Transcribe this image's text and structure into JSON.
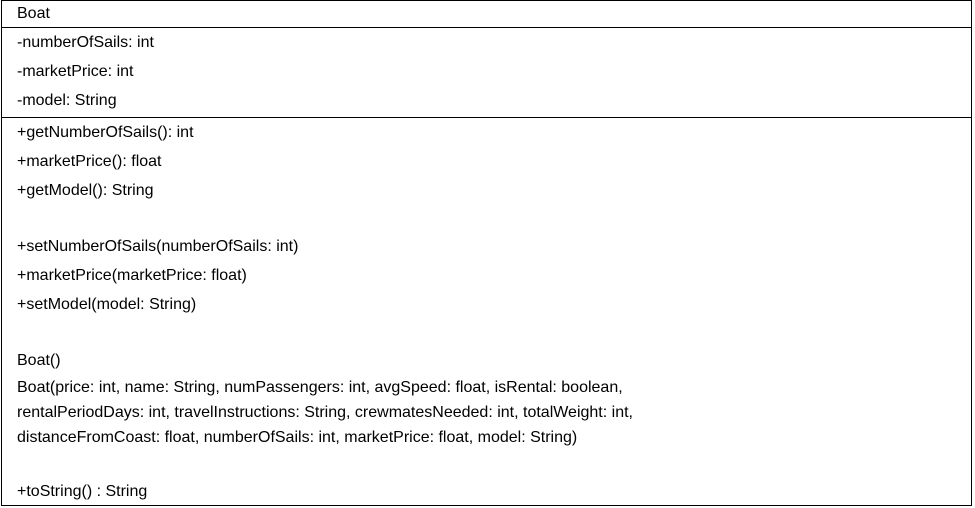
{
  "class_name": "Boat",
  "attributes": [
    "-numberOfSails: int",
    "-marketPrice: int",
    "-model: String"
  ],
  "operations": {
    "getters": [
      "+getNumberOfSails(): int",
      "+marketPrice(): float",
      "+getModel(): String"
    ],
    "setters": [
      "+setNumberOfSails(numberOfSails: int)",
      "+marketPrice(marketPrice: float)",
      "+setModel(model: String)"
    ],
    "constructors": [
      "Boat()",
      "Boat(price: int, name: String, numPassengers: int, avgSpeed: float, isRental: boolean,",
      "rentalPeriodDays: int, travelInstructions: String, crewmatesNeeded: int, totalWeight: int,",
      "distanceFromCoast: float, numberOfSails: int, marketPrice: float, model: String)"
    ],
    "other": [
      "+toString() : String"
    ]
  }
}
